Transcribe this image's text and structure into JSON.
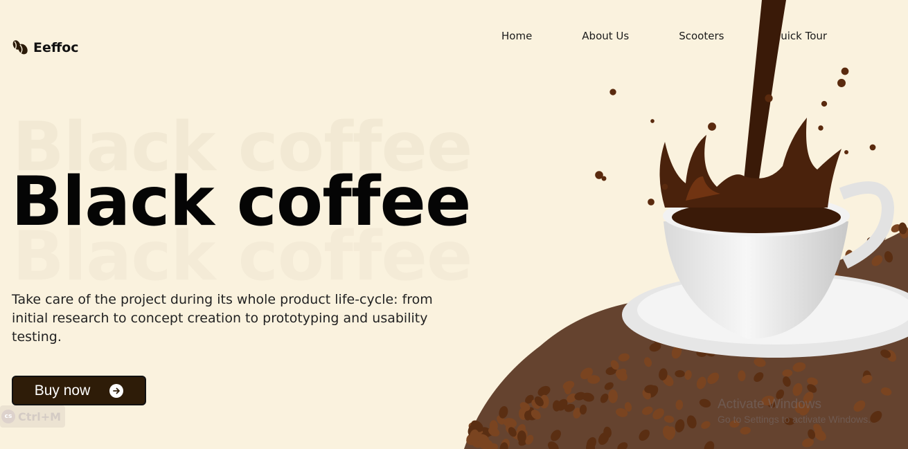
{
  "brand": {
    "name": "Eeffoc",
    "icon": "coffee-beans-icon"
  },
  "nav": {
    "items": [
      "Home",
      "About Us",
      "Scooters",
      "Quick Tour"
    ],
    "active_index": 3
  },
  "hero": {
    "title": "Black coffee",
    "ghost_text": "Black coffee",
    "description": "Take care of the project during its whole product life-cycle: from initial research to concept creation to prototyping and usability testing."
  },
  "cta": {
    "label": "Buy now",
    "icon": "arrow-right-icon"
  },
  "shortcut_hint": {
    "badge": "cs",
    "label": "Ctrl+M"
  },
  "os_watermark": {
    "line1": "Activate Windows",
    "line2": "Go to Settings to activate Windows."
  },
  "colors": {
    "background": "#faf2de",
    "button": "#2e1c08",
    "text": "#111111",
    "coffee": "#3a1a08"
  }
}
